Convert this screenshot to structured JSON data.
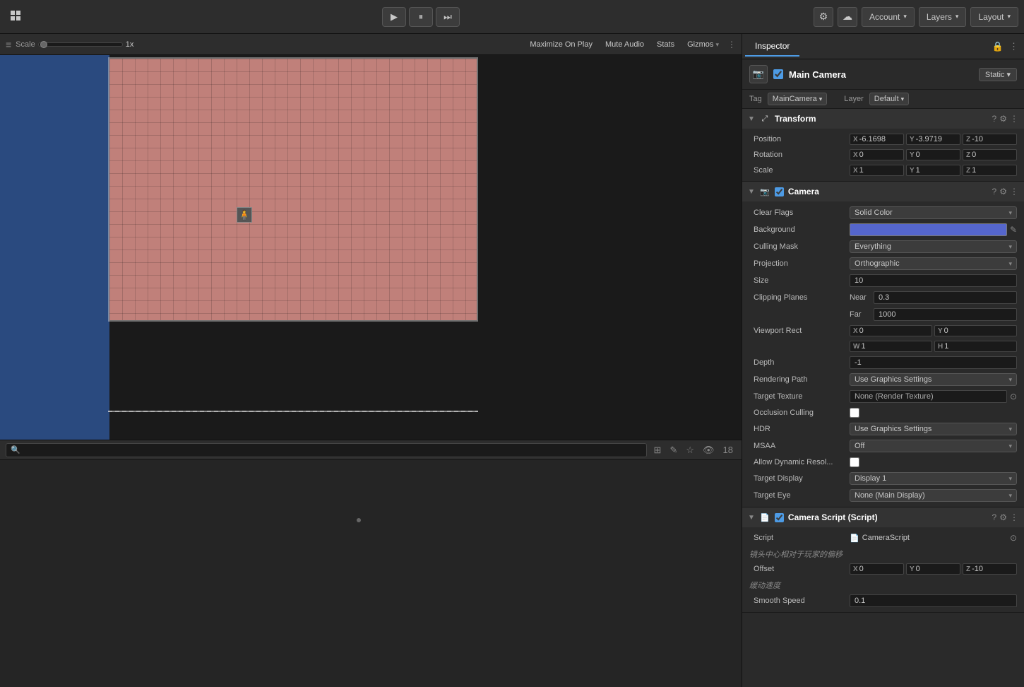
{
  "topbar": {
    "logo": "⊞",
    "play_label": "▶",
    "pause_label": "⏸",
    "step_label": "⏭",
    "cloud_icon": "☁",
    "account_label": "Account",
    "layers_label": "Layers",
    "layout_label": "Layout"
  },
  "scene_toolbar": {
    "scale_label": "Scale",
    "scale_value": "1x",
    "maximize_label": "Maximize On Play",
    "mute_label": "Mute Audio",
    "stats_label": "Stats",
    "gizmos_label": "Gizmos"
  },
  "bottom_panel": {
    "search_placeholder": "",
    "icons_count": "18"
  },
  "inspector": {
    "tab_label": "Inspector",
    "lock_icon": "🔒",
    "menu_icon": "⋮",
    "object_name": "Main Camera",
    "static_label": "Static ▾",
    "tag_label": "Tag",
    "tag_value": "MainCamera",
    "layer_label": "Layer",
    "layer_value": "Default",
    "components": {
      "transform": {
        "name": "Transform",
        "position_label": "Position",
        "pos_x": "-6.1698",
        "pos_y": "-3.9719",
        "pos_z": "-10",
        "rotation_label": "Rotation",
        "rot_x": "0",
        "rot_y": "0",
        "rot_z": "0",
        "scale_label": "Scale",
        "scale_x": "1",
        "scale_y": "1",
        "scale_z": "1"
      },
      "camera": {
        "name": "Camera",
        "clear_flags_label": "Clear Flags",
        "clear_flags_value": "Solid Color",
        "background_label": "Background",
        "culling_mask_label": "Culling Mask",
        "culling_mask_value": "Everything",
        "projection_label": "Projection",
        "projection_value": "Orthographic",
        "size_label": "Size",
        "size_value": "10",
        "clipping_label": "Clipping Planes",
        "near_label": "Near",
        "near_value": "0.3",
        "far_label": "Far",
        "far_value": "1000",
        "viewport_label": "Viewport Rect",
        "vp_x": "0",
        "vp_y": "0",
        "vp_w": "1",
        "vp_h": "1",
        "depth_label": "Depth",
        "depth_value": "-1",
        "rendering_path_label": "Rendering Path",
        "rendering_path_value": "Use Graphics Settings",
        "target_texture_label": "Target Texture",
        "target_texture_value": "None (Render Texture)",
        "occlusion_label": "Occlusion Culling",
        "hdr_label": "HDR",
        "hdr_value": "Use Graphics Settings",
        "msaa_label": "MSAA",
        "msaa_value": "Off",
        "allow_dynamic_label": "Allow Dynamic Resol...",
        "target_display_label": "Target Display",
        "target_display_value": "Display 1",
        "target_eye_label": "Target Eye",
        "target_eye_value": "None (Main Display)"
      },
      "camera_script": {
        "name": "Camera Script (Script)",
        "script_label": "Script",
        "script_value": "CameraScript",
        "section_label": "镜头中心相对于玩家的偏移",
        "offset_label": "Offset",
        "offset_x": "0",
        "offset_y": "0",
        "offset_z": "-10",
        "smooth_section_label": "缓动速度",
        "smooth_speed_label": "Smooth Speed",
        "smooth_speed_value": "0.1"
      }
    }
  }
}
